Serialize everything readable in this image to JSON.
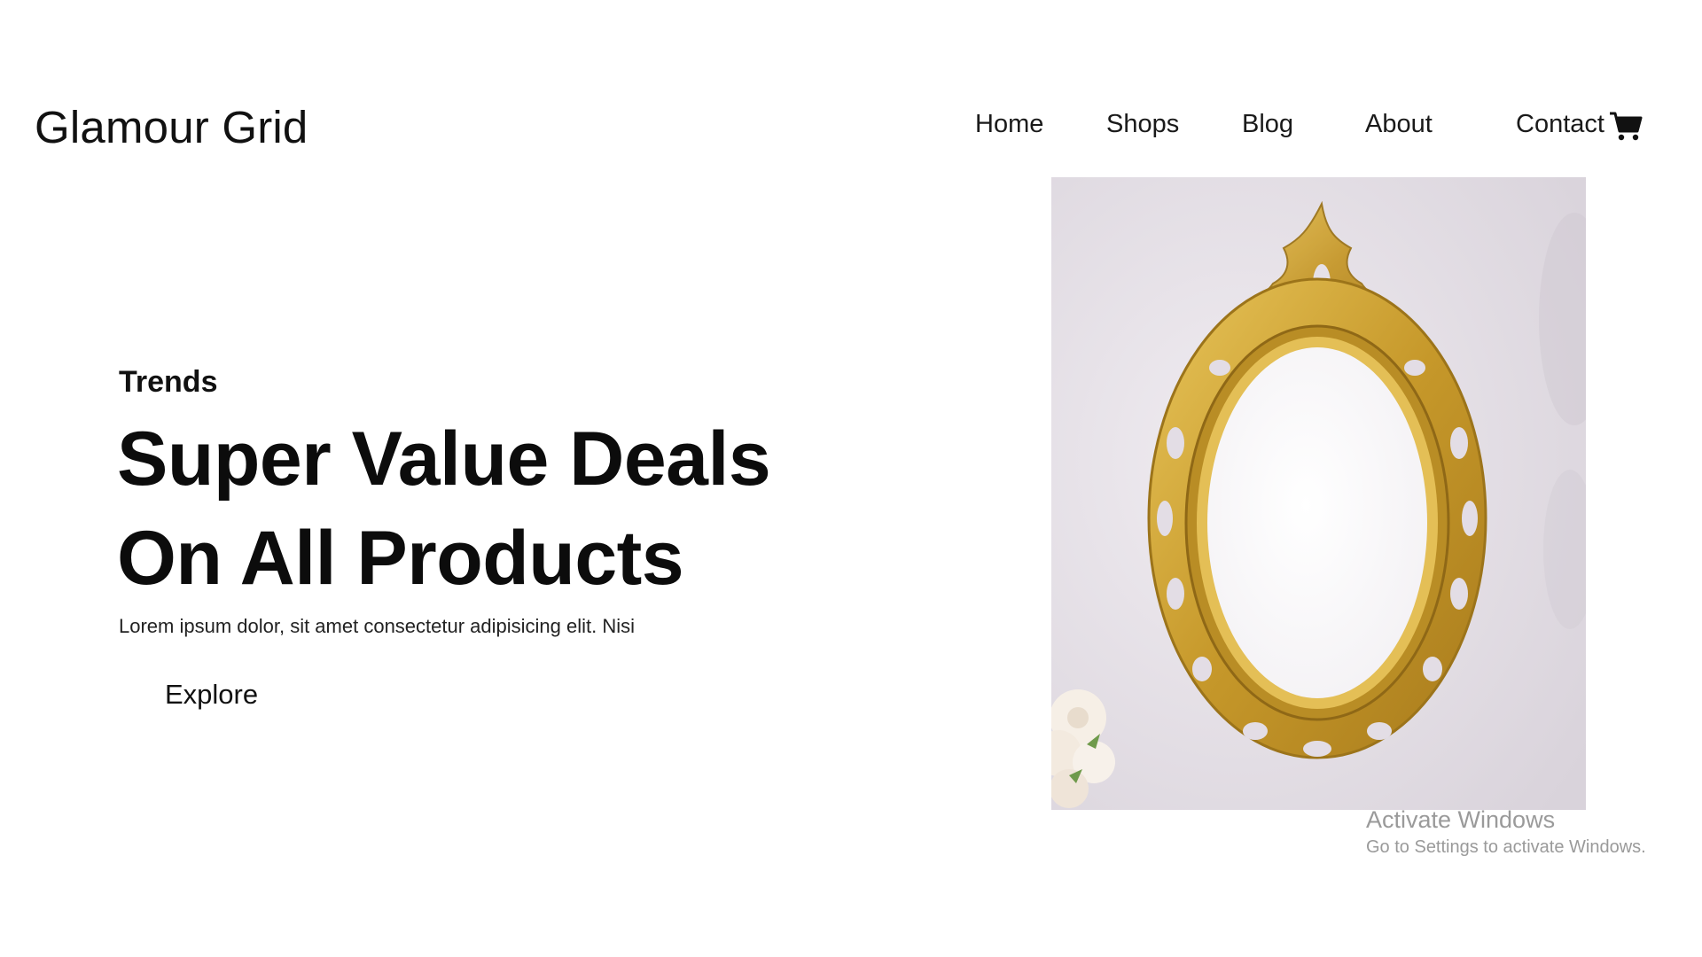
{
  "header": {
    "brand": "Glamour Grid",
    "nav": [
      "Home",
      "Shops",
      "Blog",
      "About",
      "Contact"
    ],
    "cart_icon": "cart-icon"
  },
  "hero": {
    "eyebrow": "Trends",
    "headline_line1": "Super Value Deals",
    "headline_line2": "On All Products",
    "description": "Lorem ipsum dolor, sit amet consectetur adipisicing elit. Nisi",
    "cta": "Explore",
    "image_icon": "ornate-gold-mirror-image"
  },
  "watermark": {
    "title": "Activate Windows",
    "subtitle": "Go to Settings to activate Windows."
  },
  "colors": {
    "text": "#111111",
    "frame_gold": "#c9a02e",
    "image_background": "#e6e1e8"
  }
}
